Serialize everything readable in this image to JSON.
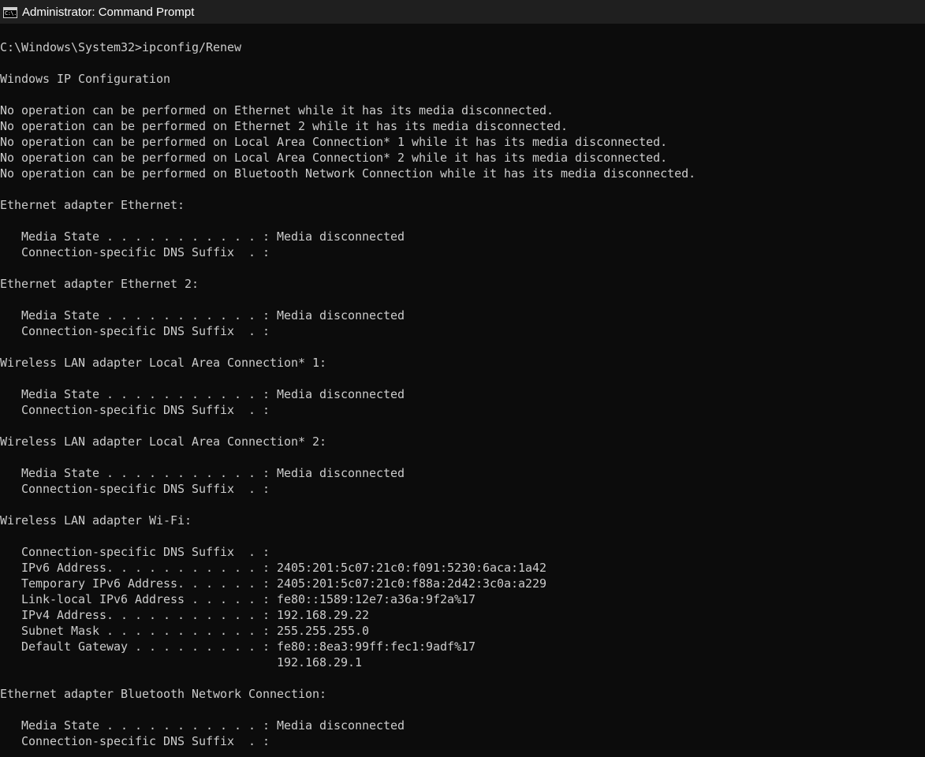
{
  "window": {
    "title": "Administrator: Command Prompt",
    "icon": "cmd-icon",
    "icon_glyph": "C:\\."
  },
  "console": {
    "lines": [
      "C:\\Windows\\System32>ipconfig/Renew",
      "",
      "Windows IP Configuration",
      "",
      "No operation can be performed on Ethernet while it has its media disconnected.",
      "No operation can be performed on Ethernet 2 while it has its media disconnected.",
      "No operation can be performed on Local Area Connection* 1 while it has its media disconnected.",
      "No operation can be performed on Local Area Connection* 2 while it has its media disconnected.",
      "No operation can be performed on Bluetooth Network Connection while it has its media disconnected.",
      "",
      "Ethernet adapter Ethernet:",
      "",
      "   Media State . . . . . . . . . . . : Media disconnected",
      "   Connection-specific DNS Suffix  . :",
      "",
      "Ethernet adapter Ethernet 2:",
      "",
      "   Media State . . . . . . . . . . . : Media disconnected",
      "   Connection-specific DNS Suffix  . :",
      "",
      "Wireless LAN adapter Local Area Connection* 1:",
      "",
      "   Media State . . . . . . . . . . . : Media disconnected",
      "   Connection-specific DNS Suffix  . :",
      "",
      "Wireless LAN adapter Local Area Connection* 2:",
      "",
      "   Media State . . . . . . . . . . . : Media disconnected",
      "   Connection-specific DNS Suffix  . :",
      "",
      "Wireless LAN adapter Wi-Fi:",
      "",
      "   Connection-specific DNS Suffix  . :",
      "   IPv6 Address. . . . . . . . . . . : 2405:201:5c07:21c0:f091:5230:6aca:1a42",
      "   Temporary IPv6 Address. . . . . . : 2405:201:5c07:21c0:f88a:2d42:3c0a:a229",
      "   Link-local IPv6 Address . . . . . : fe80::1589:12e7:a36a:9f2a%17",
      "   IPv4 Address. . . . . . . . . . . : 192.168.29.22",
      "   Subnet Mask . . . . . . . . . . . : 255.255.255.0",
      "   Default Gateway . . . . . . . . . : fe80::8ea3:99ff:fec1:9adf%17",
      "                                       192.168.29.1",
      "",
      "Ethernet adapter Bluetooth Network Connection:",
      "",
      "   Media State . . . . . . . . . . . : Media disconnected",
      "   Connection-specific DNS Suffix  . :"
    ]
  },
  "colors": {
    "background": "#0c0c0c",
    "titlebar": "#1f1f1f",
    "text": "#cccccc",
    "title_text": "#ffffff"
  }
}
